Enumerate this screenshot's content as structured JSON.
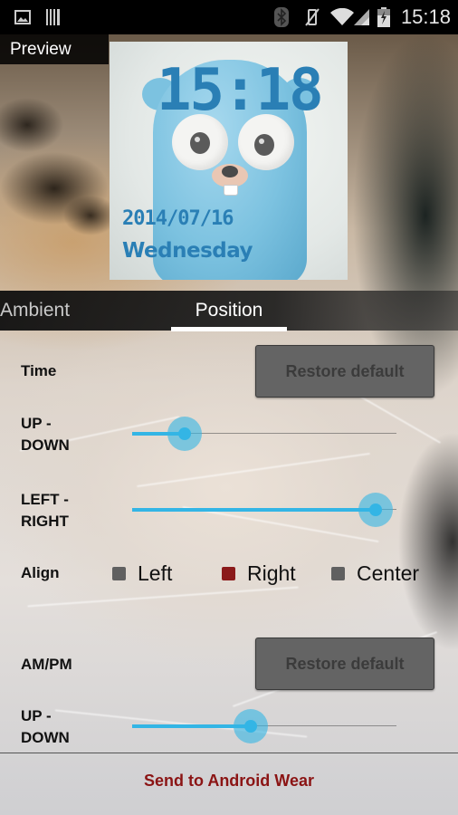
{
  "status_bar": {
    "left_icons": [
      "image-icon",
      "barcode-icon"
    ],
    "right_icons": [
      "bluetooth-icon",
      "vibrate-mute-icon",
      "wifi-icon",
      "cell-signal-icon",
      "battery-charging-icon"
    ],
    "time": "15:18"
  },
  "preview": {
    "label": "Preview",
    "watch_face": {
      "time": "15:18",
      "date": "2014/07/16",
      "day": "Wednesday",
      "text_color": "#2a7fb5",
      "image": "gopher-figure"
    }
  },
  "tabs": [
    {
      "label": "Ambient",
      "selected": false
    },
    {
      "label": "Position",
      "selected": true
    }
  ],
  "time_section": {
    "label": "Time",
    "restore_button": "Restore default",
    "up_down": {
      "label_line1": "UP -",
      "label_line2": "DOWN",
      "value": 0.2
    },
    "left_right": {
      "label_line1": "LEFT -",
      "label_line2": "RIGHT",
      "value": 0.92
    },
    "align": {
      "label": "Align",
      "options": [
        {
          "label": "Left",
          "checked": false
        },
        {
          "label": "Right",
          "checked": true
        },
        {
          "label": "Center",
          "checked": false
        }
      ]
    }
  },
  "ampm_section": {
    "label": "AM/PM",
    "restore_button": "Restore default",
    "up_down": {
      "label_line1": "UP -",
      "label_line2": "DOWN",
      "value": 0.45
    }
  },
  "send_button": "Send to Android Wear",
  "colors": {
    "accent": "#33b5e5",
    "radio_checked": "#8b1a1a",
    "send_text": "#8b1414"
  }
}
